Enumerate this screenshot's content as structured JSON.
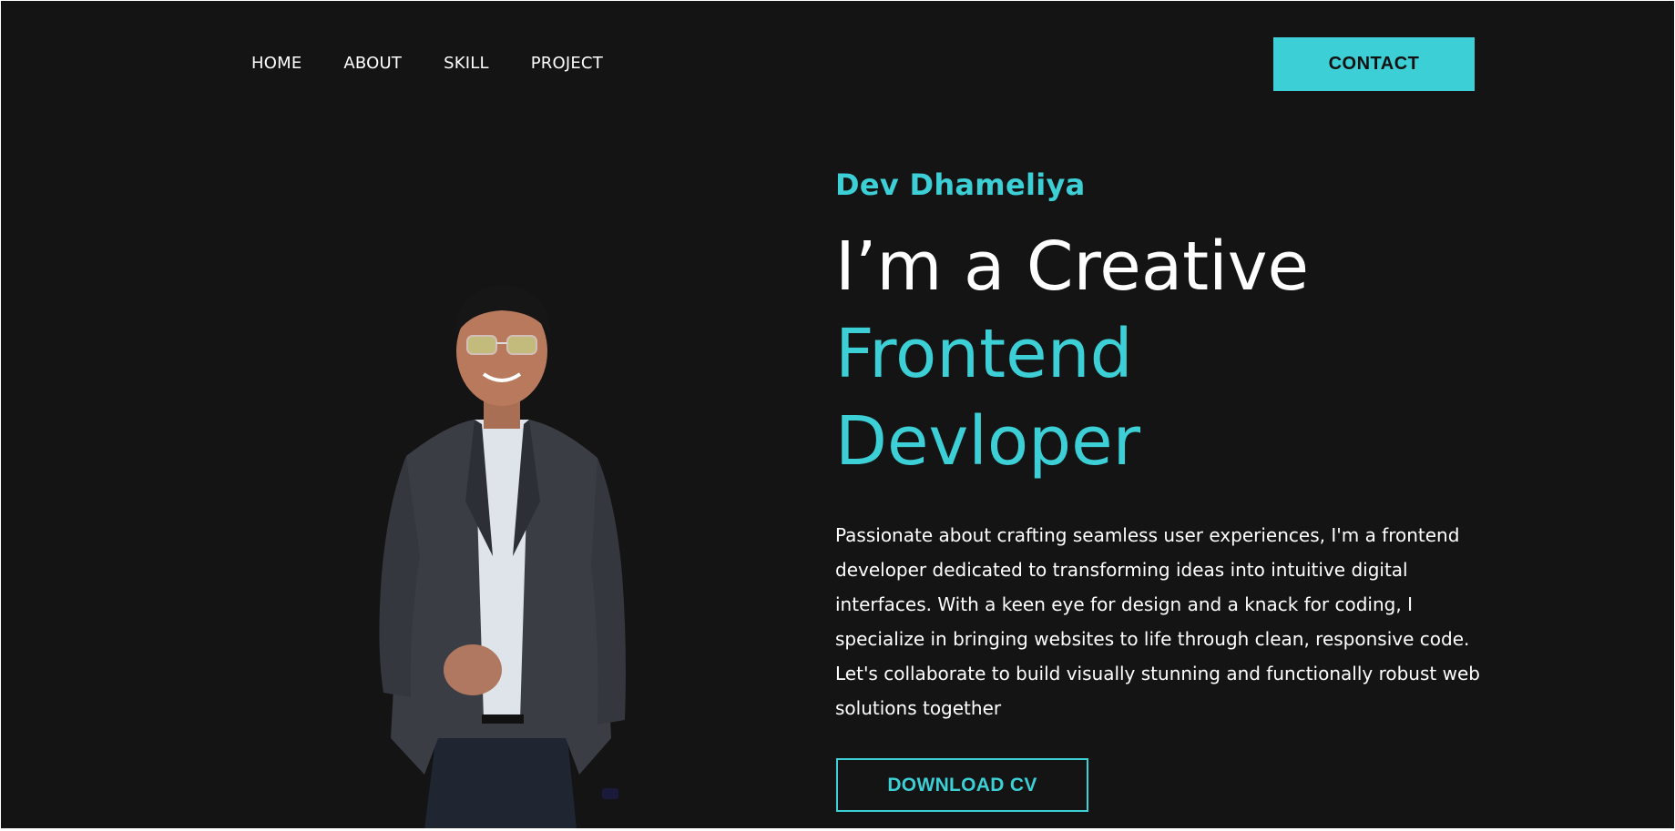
{
  "nav": {
    "items": [
      {
        "label": "HOME"
      },
      {
        "label": "ABOUT"
      },
      {
        "label": "SKILL"
      },
      {
        "label": "PROJECT"
      }
    ],
    "contact_label": "CONTACT"
  },
  "hero": {
    "name": "Dev Dhameliya",
    "title_line1": "I’m a Creative",
    "title_line2": "Frontend",
    "title_line3": "Devloper",
    "description": "Passionate about crafting seamless user experiences, I'm a frontend developer dedicated to transforming ideas into intuitive digital interfaces. With a keen eye for design and a knack for coding, I specialize in bringing websites to life through clean, responsive code. Let's collaborate to build visually stunning and functionally robust web solutions together",
    "download_label": "DOWNLOAD CV"
  },
  "colors": {
    "background": "#141414",
    "accent": "#3ccfd6",
    "text": "#ffffff"
  }
}
